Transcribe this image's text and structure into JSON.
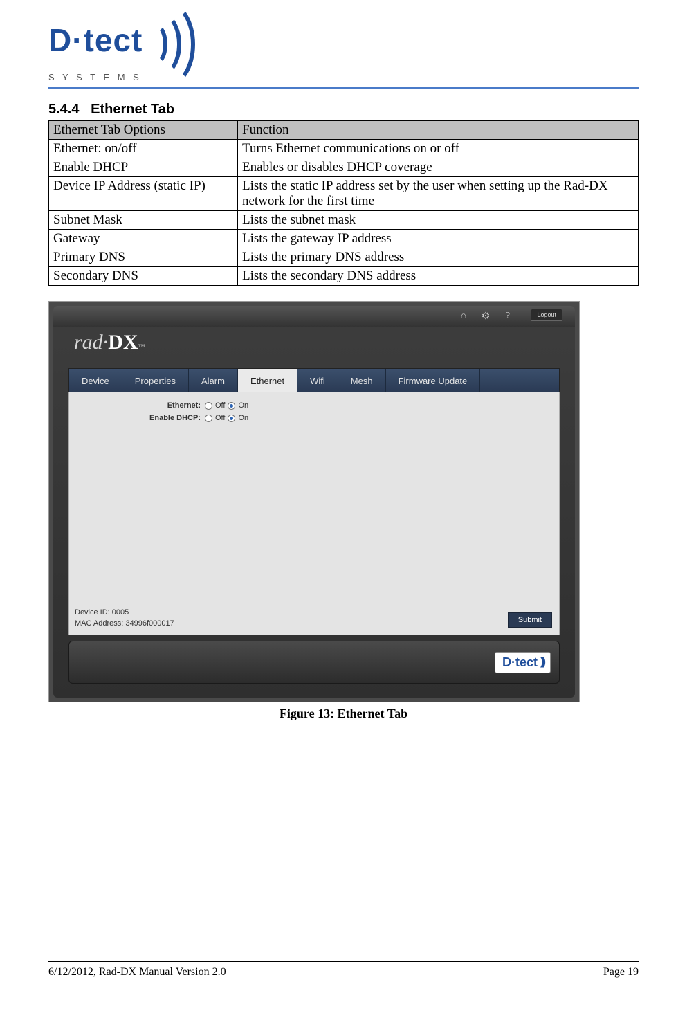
{
  "header": {
    "logo_text": "D·tect",
    "logo_sub": "S Y S T E M S"
  },
  "section": {
    "number": "5.4.4",
    "title": "Ethernet Tab"
  },
  "table": {
    "header_option": "Ethernet Tab Options",
    "header_function": "Function",
    "rows": [
      {
        "option": "Ethernet: on/off",
        "function": "Turns Ethernet communications on or off"
      },
      {
        "option": "Enable DHCP",
        "function": "Enables or disables DHCP coverage"
      },
      {
        "option": "Device IP Address (static IP)",
        "function": "Lists the static IP address set by the user when setting up the Rad-DX network for the first time"
      },
      {
        "option": "Subnet Mask",
        "function": "Lists the subnet mask"
      },
      {
        "option": "Gateway",
        "function": "Lists the gateway IP address"
      },
      {
        "option": "Primary DNS",
        "function": "Lists the primary DNS address"
      },
      {
        "option": "Secondary DNS",
        "function": "Lists the secondary DNS address"
      }
    ]
  },
  "screenshot": {
    "logout": "Logout",
    "brand_prefix": "rad·",
    "brand_suffix": "DX",
    "brand_tm": "™",
    "tabs": [
      "Device",
      "Properties",
      "Alarm",
      "Ethernet",
      "Wifi",
      "Mesh",
      "Firmware Update"
    ],
    "active_tab_index": 3,
    "form": {
      "ethernet_label": "Ethernet:",
      "dhcp_label": "Enable DHCP:",
      "off": "Off",
      "on": "On"
    },
    "device_id": "Device ID: 0005",
    "mac": "MAC Address: 34996f000017",
    "submit": "Submit",
    "footer_logo": "D·tect"
  },
  "figure_caption": "Figure 13: Ethernet Tab",
  "footer": {
    "left": "6/12/2012, Rad-DX Manual Version 2.0",
    "right": "Page 19"
  }
}
